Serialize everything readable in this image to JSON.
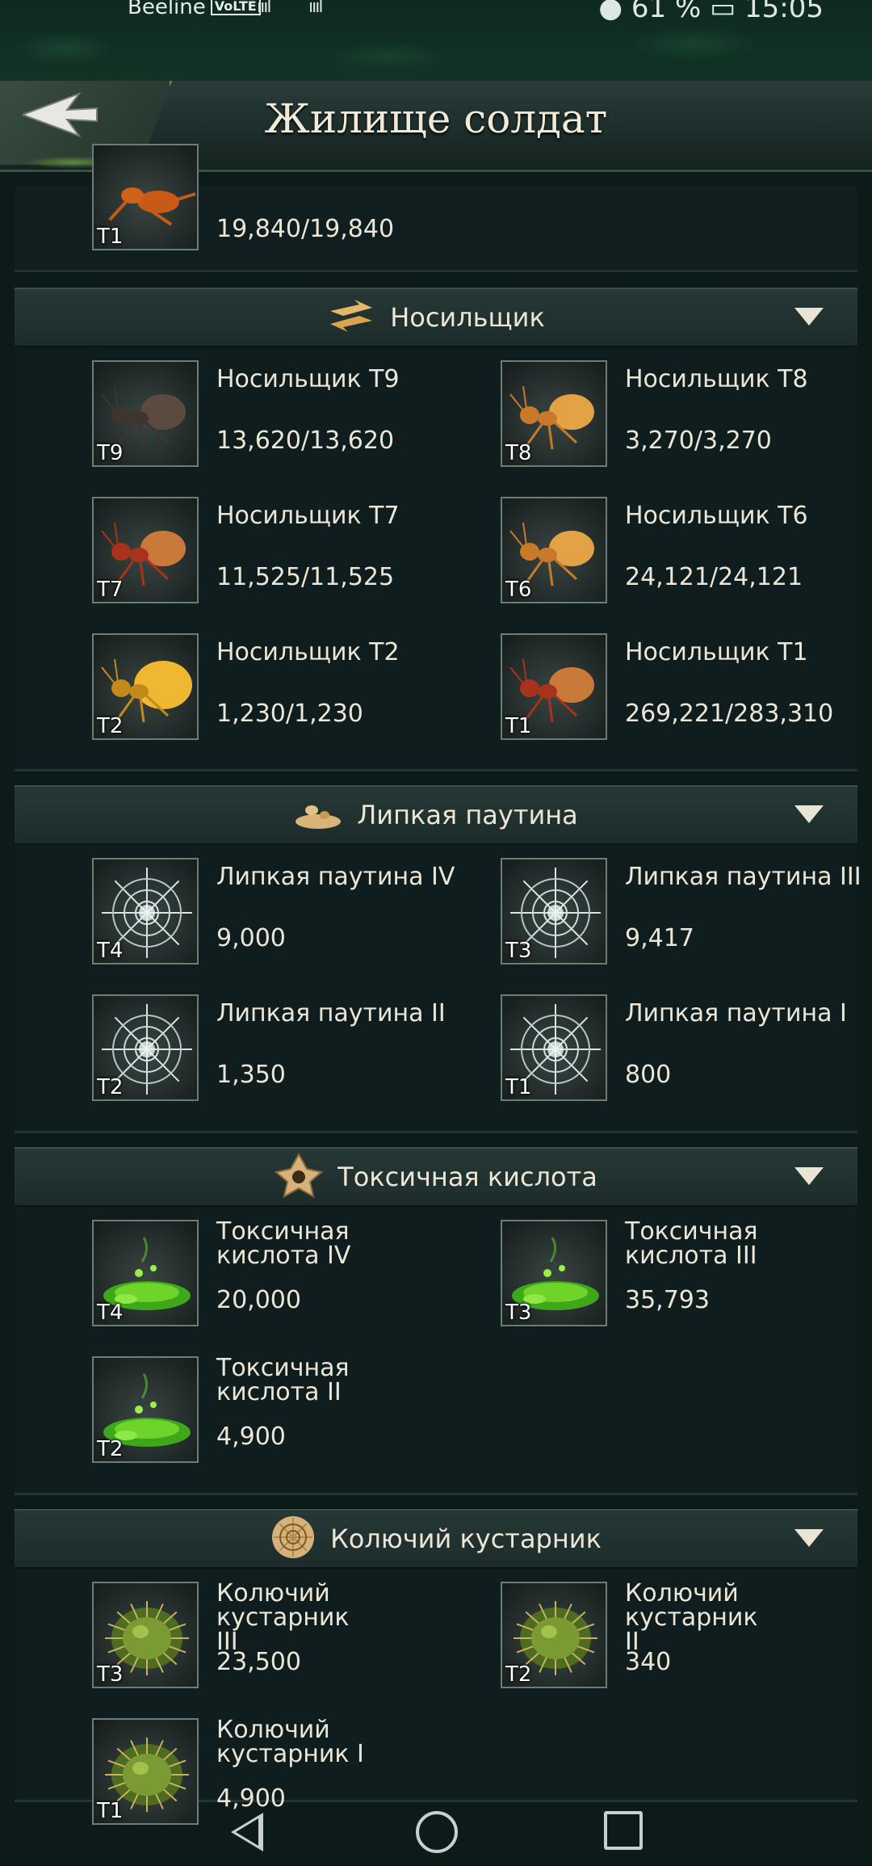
{
  "status_bar": {
    "carrier": "Beeline",
    "volte": "VoLTE",
    "signal1": "ıııl",
    "signal2": "ıııl",
    "right": "● 61 %  ▭  15:05"
  },
  "header": {
    "title": "Жилище солдат"
  },
  "top_item": {
    "tier": "T1",
    "count": "19,840/19,840"
  },
  "sections": [
    {
      "name": "Носильщик",
      "icon": "carrier-ant-icon",
      "items": [
        {
          "name": "Носильщик T9",
          "count": "13,620/13,620",
          "tier": "T9",
          "kind": "ant-dark"
        },
        {
          "name": "Носильщик T8",
          "count": "3,270/3,270",
          "tier": "T8",
          "kind": "ant-gold"
        },
        {
          "name": "Носильщик T7",
          "count": "11,525/11,525",
          "tier": "T7",
          "kind": "ant-red"
        },
        {
          "name": "Носильщик T6",
          "count": "24,121/24,121",
          "tier": "T6",
          "kind": "ant-gold"
        },
        {
          "name": "Носильщик T2",
          "count": "1,230/1,230",
          "tier": "T2",
          "kind": "ant-honey"
        },
        {
          "name": "Носильщик T1",
          "count": "269,221/283,310",
          "tier": "T1",
          "kind": "ant-red"
        }
      ]
    },
    {
      "name": "Липкая паутина",
      "icon": "sticky-web-icon",
      "items": [
        {
          "name": "Липкая паутина IV",
          "count": "9,000",
          "tier": "T4",
          "kind": "web"
        },
        {
          "name": "Липкая паутина III",
          "count": "9,417",
          "tier": "T3",
          "kind": "web"
        },
        {
          "name": "Липкая паутина II",
          "count": "1,350",
          "tier": "T2",
          "kind": "web"
        },
        {
          "name": "Липкая паутина I",
          "count": "800",
          "tier": "T1",
          "kind": "web"
        }
      ]
    },
    {
      "name": "Токсичная кислота",
      "icon": "toxic-acid-icon",
      "items": [
        {
          "name": "Токсичная кислота IV",
          "count": "20,000",
          "tier": "T4",
          "kind": "acid"
        },
        {
          "name": "Токсичная кислота III",
          "count": "35,793",
          "tier": "T3",
          "kind": "acid"
        },
        {
          "name": "Токсичная кислота II",
          "count": "4,900",
          "tier": "T2",
          "kind": "acid"
        }
      ]
    },
    {
      "name": "Колючий кустарник",
      "icon": "thorn-bush-icon",
      "items": [
        {
          "name": "Колючий кустарник III",
          "count": "23,500",
          "tier": "T3",
          "kind": "thorn"
        },
        {
          "name": "Колючий кустарник II",
          "count": "340",
          "tier": "T2",
          "kind": "thorn"
        },
        {
          "name": "Колючий кустарник I",
          "count": "4,900",
          "tier": "T1",
          "kind": "thorn"
        }
      ]
    }
  ]
}
